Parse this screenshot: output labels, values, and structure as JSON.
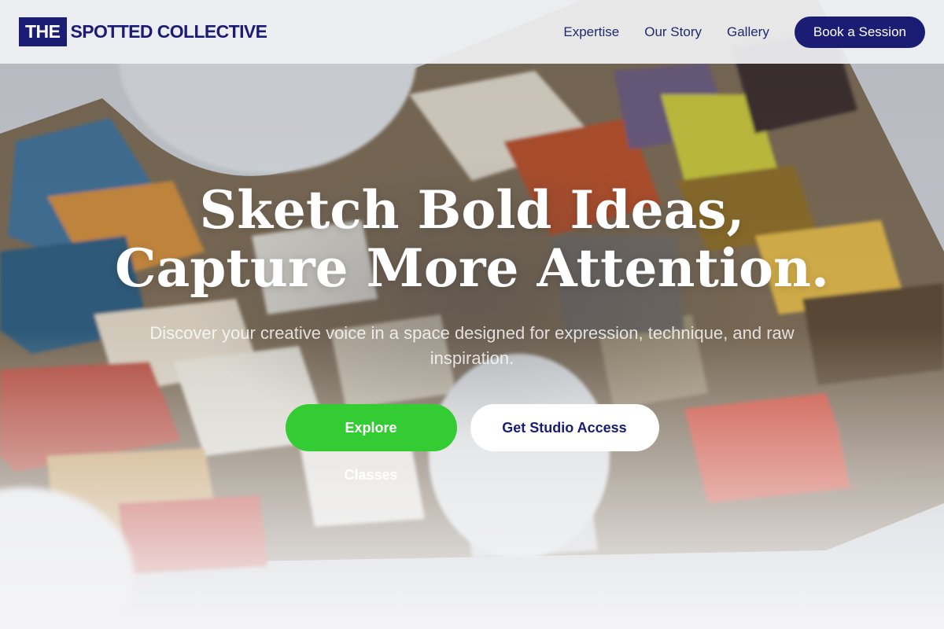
{
  "nav": {
    "brand_box": "THE",
    "brand_text": "SPOTTED COLLECTIVE",
    "links": [
      "Expertise",
      "Our Story",
      "Gallery"
    ],
    "cta": "Book a Session"
  },
  "hero": {
    "headline_line1": "Sketch Bold Ideas,",
    "headline_line2": "Capture More Attention.",
    "subtitle": "Discover your creative voice in a space designed for expression, technique, and raw inspiration.",
    "primary_cta": "Explore Classes",
    "secondary_cta": "Get Studio Access"
  },
  "colors": {
    "brand_navy": "#1b1c73",
    "accent_green": "#33cc33",
    "white": "#ffffff"
  }
}
